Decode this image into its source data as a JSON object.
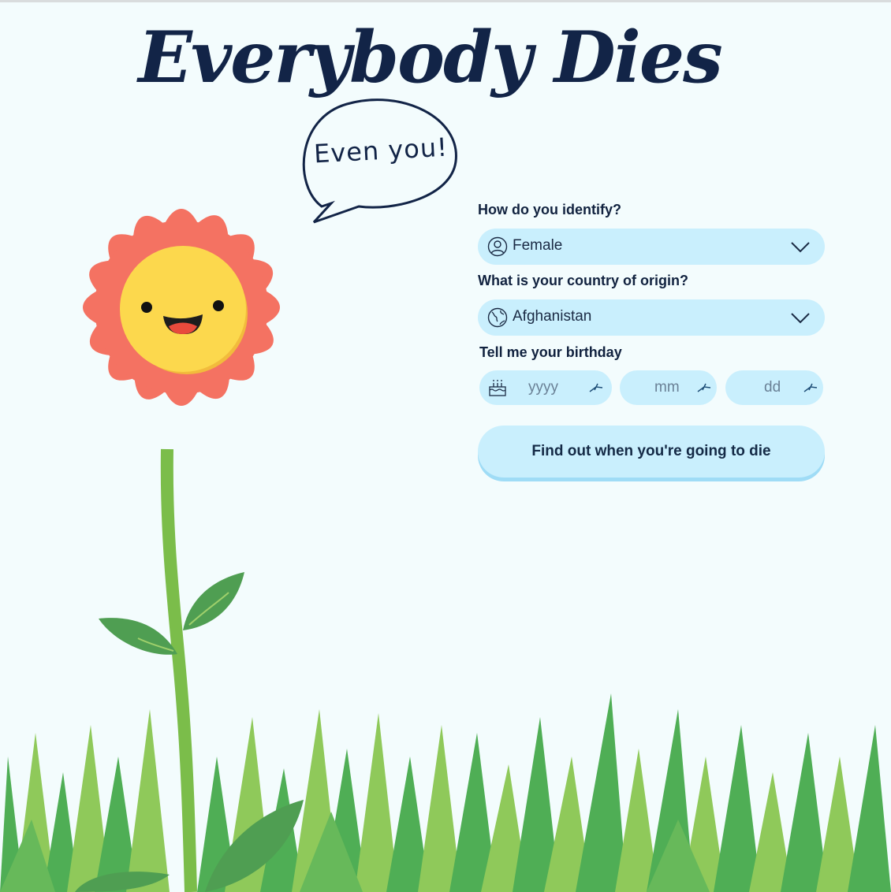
{
  "page": {
    "title": "Everybody Dies",
    "bubble_text": "Even you!"
  },
  "form": {
    "gender": {
      "label": "How do you identify?",
      "value": "Female",
      "icon": "user-circle-icon"
    },
    "country": {
      "label": "What is your country of origin?",
      "value": "Afghanistan",
      "icon": "globe-icon"
    },
    "birthday": {
      "label": "Tell me your birthday",
      "year_placeholder": "yyyy",
      "month_placeholder": "mm",
      "day_placeholder": "dd",
      "icon": "birthday-cake-icon"
    },
    "submit_label": "Find out when you're going to die"
  },
  "colors": {
    "background": "#f3fcfd",
    "input_fill": "#c9effd",
    "text_dark": "#11223f",
    "petal": "#f47262",
    "face": "#fcd84d",
    "grass_dark": "#4fae55",
    "grass_light": "#8fc95a"
  }
}
